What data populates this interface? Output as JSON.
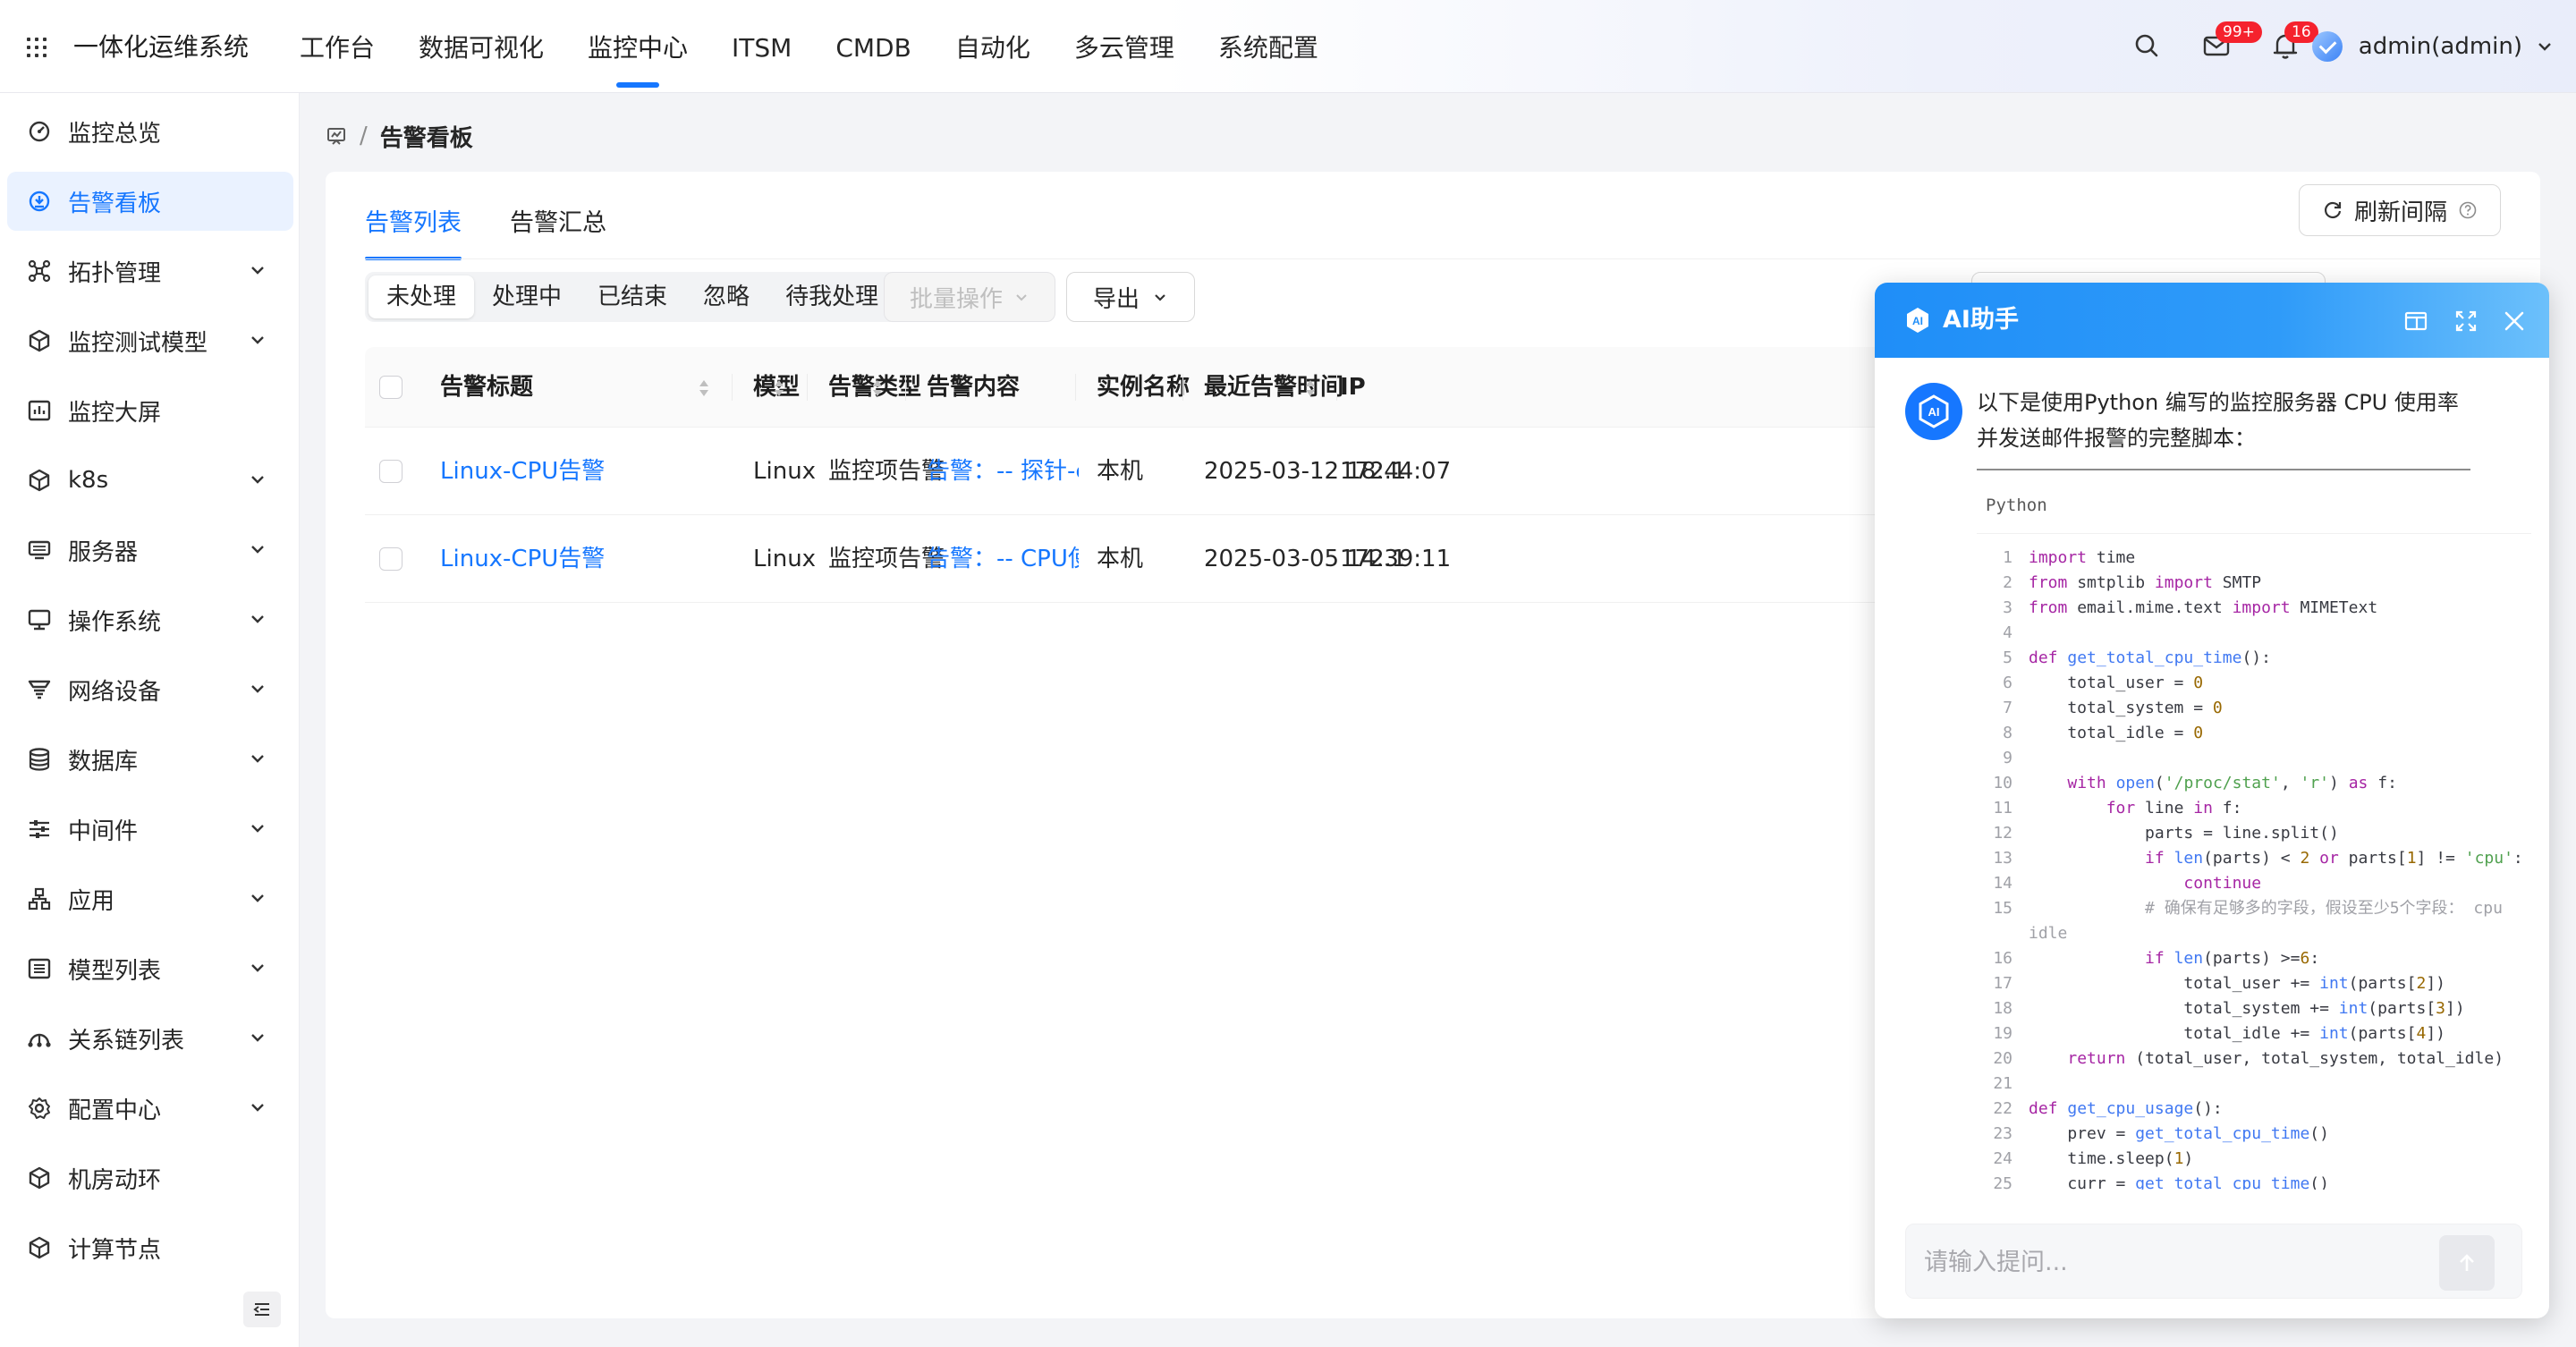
{
  "app": {
    "title": "一体化运维系统"
  },
  "nav": {
    "items": [
      "工作台",
      "数据可视化",
      "监控中心",
      "ITSM",
      "CMDB",
      "自动化",
      "多云管理",
      "系统配置"
    ],
    "active": "监控中心"
  },
  "header": {
    "mail_badge": "99+",
    "bell_badge": "16",
    "user": "admin(admin)"
  },
  "sidebar": {
    "items": [
      {
        "label": "监控总览",
        "icon": "dashboard-icon",
        "expandable": false
      },
      {
        "label": "告警看板",
        "icon": "alert-board-icon",
        "expandable": false,
        "active": true
      },
      {
        "label": "拓扑管理",
        "icon": "topology-icon",
        "expandable": true
      },
      {
        "label": "监控测试模型",
        "icon": "cube-icon",
        "expandable": true
      },
      {
        "label": "监控大屏",
        "icon": "chart-screen-icon",
        "expandable": false
      },
      {
        "label": "k8s",
        "icon": "cube-icon",
        "expandable": true
      },
      {
        "label": "服务器",
        "icon": "server-icon",
        "expandable": true
      },
      {
        "label": "操作系统",
        "icon": "monitor-icon",
        "expandable": true
      },
      {
        "label": "网络设备",
        "icon": "network-icon",
        "expandable": true
      },
      {
        "label": "数据库",
        "icon": "database-icon",
        "expandable": true
      },
      {
        "label": "中间件",
        "icon": "sliders-icon",
        "expandable": true
      },
      {
        "label": "应用",
        "icon": "app-icon",
        "expandable": true
      },
      {
        "label": "模型列表",
        "icon": "list-icon",
        "expandable": true
      },
      {
        "label": "关系链列表",
        "icon": "relation-icon",
        "expandable": true
      },
      {
        "label": "配置中心",
        "icon": "gear-icon",
        "expandable": true
      },
      {
        "label": "机房动环",
        "icon": "cube-icon",
        "expandable": false
      },
      {
        "label": "计算节点",
        "icon": "cube-icon",
        "expandable": false
      }
    ]
  },
  "breadcrumb": {
    "separator": "/",
    "current": "告警看板"
  },
  "tabs": [
    "告警列表",
    "告警汇总"
  ],
  "refresh": {
    "label": "刷新间隔"
  },
  "filters": [
    "未处理",
    "处理中",
    "已结束",
    "忽略",
    "待我处理"
  ],
  "batch": {
    "label": "批量操作"
  },
  "export": {
    "label": "导出"
  },
  "table": {
    "columns": [
      "告警标题",
      "模型",
      "告警类型",
      "告警内容",
      "实例名称",
      "最近告警时间",
      "IP"
    ],
    "rows": [
      [
        "Linux-CPU告警",
        "Linux",
        "监控项告警",
        "告警：-- 探针-cpu 告警...",
        "本机",
        "2025-03-12 18:44:07",
        "172.1"
      ],
      [
        "Linux-CPU告警",
        "Linux",
        "监控项告警",
        "告警：-- CPU使用率qqq ...",
        "本机",
        "2025-03-05 14:39:11",
        "172.1"
      ]
    ]
  },
  "ai": {
    "title": "AI助手",
    "message": "以下是使用Python 编写的监控服务器 CPU 使用率并发送邮件报警的完整脚本：",
    "code_lang": "Python",
    "code_lines": [
      "import time",
      "from smtplib import SMTP",
      "from email.mime.text import MIMEText",
      "",
      "def get_total_cpu_time():",
      "    total_user = 0",
      "    total_system = 0",
      "    total_idle = 0",
      "",
      "    with open('/proc/stat', 'r') as f:",
      "        for line in f:",
      "            parts = line.split()",
      "            if len(parts) < 2 or parts[1] != 'cpu':",
      "                continue",
      "            # 确保有足够多的字段，假设至少5个字段： cpu idle",
      "            if len(parts) >=6:",
      "                total_user += int(parts[2])",
      "                total_system += int(parts[3])",
      "                total_idle += int(parts[4])",
      "    return (total_user, total_system, total_idle)",
      "",
      "def get_cpu_usage():",
      "    prev = get_total_cpu_time()",
      "    time.sleep(1)",
      "    curr = get_total_cpu_time()"
    ],
    "input_placeholder": "请输入提问..."
  },
  "colors": {
    "primary": "#1677ff",
    "badge": "#f5222d",
    "ai_header": "#1f8ef8"
  }
}
